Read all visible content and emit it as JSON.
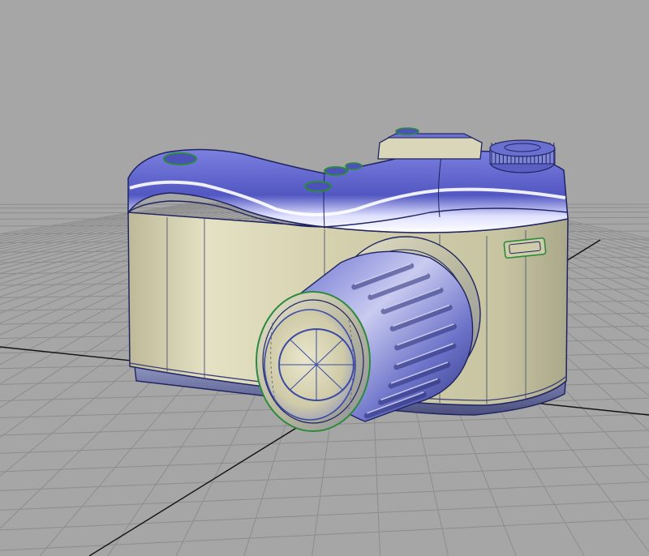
{
  "viewport": {
    "background": "#a6a6a6",
    "grid_color": "#8a8a8a",
    "axis_color": "#111111"
  },
  "model": {
    "object": "camera-3d-model",
    "body_color": "#d6d2ae",
    "top_color": "#5c61c8",
    "highlight_color": "#ffffff",
    "edge_color": "#1f2460",
    "accent_edge_color": "#2c8a3c",
    "lens_color": "#d6d2ae",
    "lens_ring_color": "#3b4aa5"
  }
}
